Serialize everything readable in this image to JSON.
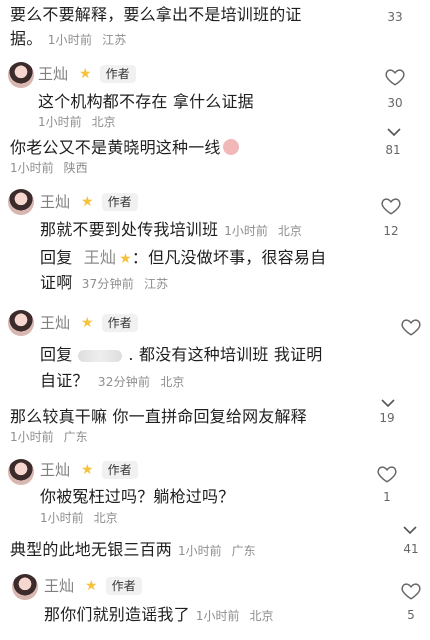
{
  "c1": {
    "text1": "要么不要解释，要么拿出不是培训班的证",
    "text2": "据。",
    "time": "1小时前",
    "loc": "江苏",
    "count": "33"
  },
  "c2": {
    "name": "王灿",
    "tag": "作者",
    "text": "这个机构都不存在 拿什么证据",
    "time": "1小时前",
    "loc": "北京",
    "count": "30"
  },
  "c3": {
    "text": "你老公又不是黄晓明这种一线",
    "time": "1小时前",
    "loc": "陕西",
    "count": "81"
  },
  "c4": {
    "name": "王灿",
    "tag": "作者",
    "text": "那就不要到处传我培训班",
    "time": "1小时前",
    "loc": "北京",
    "count": "12"
  },
  "c5": {
    "reply": "回复",
    "name": "王灿",
    "text1": "：但凡没做坏事，很容易自",
    "text2": "证啊",
    "time": "37分钟前",
    "loc": "江苏"
  },
  "c6": {
    "name": "王灿",
    "tag": "作者",
    "reply": "回复",
    "text1": ". 都没有这种培训班 我证明",
    "text2": "自证？",
    "time": "32分钟前",
    "loc": "北京"
  },
  "c7": {
    "text": "那么较真干嘛 你一直拼命回复给网友解释",
    "time": "1小时前",
    "loc": "广东",
    "count": "19"
  },
  "c8": {
    "name": "王灿",
    "tag": "作者",
    "text": "你被冤枉过吗？躺枪过吗？",
    "time": "1小时前",
    "loc": "北京",
    "count": "1"
  },
  "c9": {
    "text": "典型的此地无银三百两",
    "time": "1小时前",
    "loc": "广东",
    "count": "41"
  },
  "c10": {
    "name": "王灿",
    "tag": "作者",
    "text": "那你们就别造谣我了",
    "time": "1小时前",
    "loc": "北京",
    "count": "5"
  },
  "icons": {
    "like": "heart-outline-icon",
    "dislike": "chevron-down-icon",
    "verified": "star-icon"
  }
}
